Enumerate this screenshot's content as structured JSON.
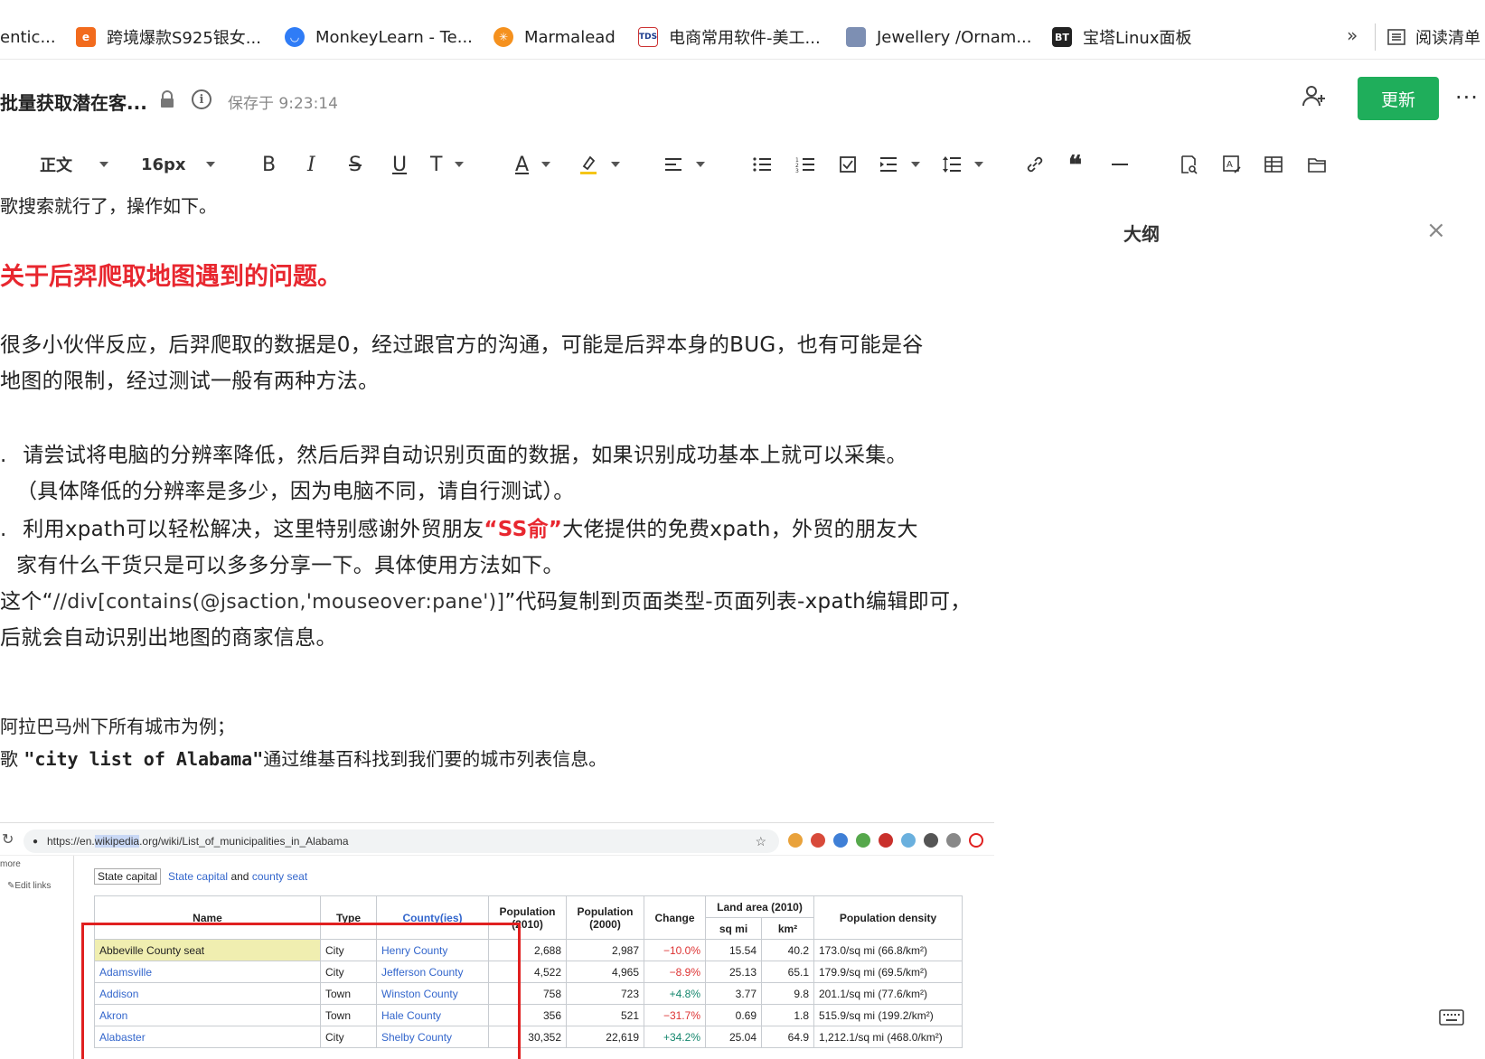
{
  "bookmarks": {
    "items": [
      {
        "label": "entic...",
        "icon": "generic-page-icon",
        "color": "#ffffff"
      },
      {
        "label": "跨境爆款S925银女...",
        "icon": "orange-e-icon",
        "color": "#f26b1d"
      },
      {
        "label": "MonkeyLearn - Te...",
        "icon": "monkeylearn-icon",
        "color": "#2f7cf6"
      },
      {
        "label": "Marmalead",
        "icon": "marmalead-icon",
        "color": "#f5911e"
      },
      {
        "label": "电商常用软件-美工...",
        "icon": "tds-icon",
        "color": "#1a3a8c"
      },
      {
        "label": "Jewellery /Ornam...",
        "icon": "page-icon",
        "color": "#7d8fb3"
      },
      {
        "label": "宝塔Linux面板",
        "icon": "bt-icon",
        "color": "#222222"
      }
    ],
    "more": "»",
    "reading_list": "阅读清单"
  },
  "doc": {
    "title": "批量获取潜在客...",
    "saved": "保存于 9:23:14",
    "update_button": "更新",
    "more": "···",
    "info": "i"
  },
  "toolbar": {
    "paragraph_style": "正文",
    "font_size": "16px",
    "bold": "B",
    "italic": "I",
    "strike": "S",
    "underline": "U",
    "clear_format": "T",
    "font_color": "A"
  },
  "outline": {
    "title": "大纲",
    "close": "×"
  },
  "content": {
    "line1": "歌搜索就行了，操作如下。",
    "heading": "关于后羿爬取地图遇到的问题。",
    "para1_a": "很多小伙伴反应，后羿爬取的数据是0，经过跟官方的沟通，可能是后羿本身的BUG，也有可能是谷",
    "para1_b": "地图的限制，经过测试一般有两种方法。",
    "item1_num": ".",
    "item1_a": "请尝试将电脑的分辨率降低，然后后羿自动识别页面的数据，如果识别成功基本上就可以采集。",
    "item1_b": "（具体降低的分辨率是多少，因为电脑不同，请自行测试）。",
    "item2_num": ".",
    "item2_pre": "利用xpath可以轻松解决，这里特别感谢外贸朋友",
    "item2_highlight": "“SS俞”",
    "item2_post": "大佬提供的免费xpath，外贸的朋友大",
    "item2_b": "家有什么干货只是可以多多分享一下。具体使用方法如下。",
    "xpath_pre": "这个“",
    "xpath_code": "//div[contains(@jsaction,'mouseover:pane')]",
    "xpath_post": "”代码复制到页面类型-页面列表-xpath编辑即可，",
    "xpath_b": "后就会自动识别出地图的商家信息。",
    "example_a": "阿拉巴马州下所有城市为例；",
    "example_b_pre": "歌 ",
    "example_b_query": "\"city list of Alabama\"",
    "example_b_post": "通过维基百科找到我们要的城市列表信息。"
  },
  "screenshot": {
    "url_pre": "https://en.",
    "url_hl": "wikipedia",
    "url_post": ".org/wiki/List_of_municipalities_in_Alabama",
    "left_more": "more",
    "left_edit": "✎Edit links",
    "legend_cap": "State capital",
    "legend_text1": "State capital",
    "legend_and": "and",
    "legend_text2": "county seat",
    "headers": {
      "name": "Name",
      "type": "Type",
      "county": "County(ies)",
      "pop2010": "Population (2010)",
      "pop2000": "Population (2000)",
      "change": "Change",
      "land": "Land area (2010)",
      "sqmi": "sq mi",
      "km2": "km²",
      "density": "Population density"
    },
    "rows": [
      {
        "name": "Abbeville",
        "badge": "County seat",
        "type": "City",
        "county": "Henry County",
        "pop2010": "2,688",
        "pop2000": "2,987",
        "change": "−10.0%",
        "sqmi": "15.54",
        "km2": "40.2",
        "density": "173.0/sq mi (66.8/km²)"
      },
      {
        "name": "Adamsville",
        "badge": "",
        "type": "City",
        "county": "Jefferson County",
        "pop2010": "4,522",
        "pop2000": "4,965",
        "change": "−8.9%",
        "sqmi": "25.13",
        "km2": "65.1",
        "density": "179.9/sq mi (69.5/km²)"
      },
      {
        "name": "Addison",
        "badge": "",
        "type": "Town",
        "county": "Winston County",
        "pop2010": "758",
        "pop2000": "723",
        "change": "+4.8%",
        "sqmi": "3.77",
        "km2": "9.8",
        "density": "201.1/sq mi (77.6/km²)"
      },
      {
        "name": "Akron",
        "badge": "",
        "type": "Town",
        "county": "Hale County",
        "pop2010": "356",
        "pop2000": "521",
        "change": "−31.7%",
        "sqmi": "0.69",
        "km2": "1.8",
        "density": "515.9/sq mi (199.2/km²)"
      },
      {
        "name": "Alabaster",
        "badge": "",
        "type": "City",
        "county": "Shelby County",
        "pop2010": "30,352",
        "pop2000": "22,619",
        "change": "+34.2%",
        "sqmi": "25.04",
        "km2": "64.9",
        "density": "1,212.1/sq mi (468.0/km²)"
      }
    ]
  }
}
